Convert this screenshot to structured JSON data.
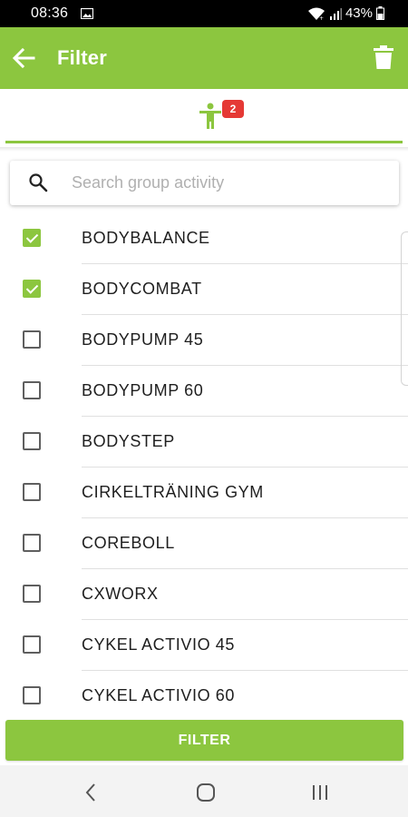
{
  "status_bar": {
    "time": "08:36",
    "battery": "43%"
  },
  "header": {
    "title": "Filter"
  },
  "tab": {
    "badge_count": "2",
    "icon": "person-activity-icon"
  },
  "search": {
    "placeholder": "Search group activity",
    "value": ""
  },
  "activities": [
    {
      "label": "BODYBALANCE",
      "checked": true
    },
    {
      "label": "BODYCOMBAT",
      "checked": true
    },
    {
      "label": "BODYPUMP 45",
      "checked": false
    },
    {
      "label": "BODYPUMP 60",
      "checked": false
    },
    {
      "label": "BODYSTEP",
      "checked": false
    },
    {
      "label": "CIRKELTRÄNING GYM",
      "checked": false
    },
    {
      "label": "COREBOLL",
      "checked": false
    },
    {
      "label": "CXWORX",
      "checked": false
    },
    {
      "label": "CYKEL ACTIVIO 45",
      "checked": false
    },
    {
      "label": "CYKEL ACTIVIO 60",
      "checked": false
    }
  ],
  "footer": {
    "filter_label": "FILTER"
  },
  "colors": {
    "accent": "#8cc63f",
    "badge": "#e53935"
  }
}
